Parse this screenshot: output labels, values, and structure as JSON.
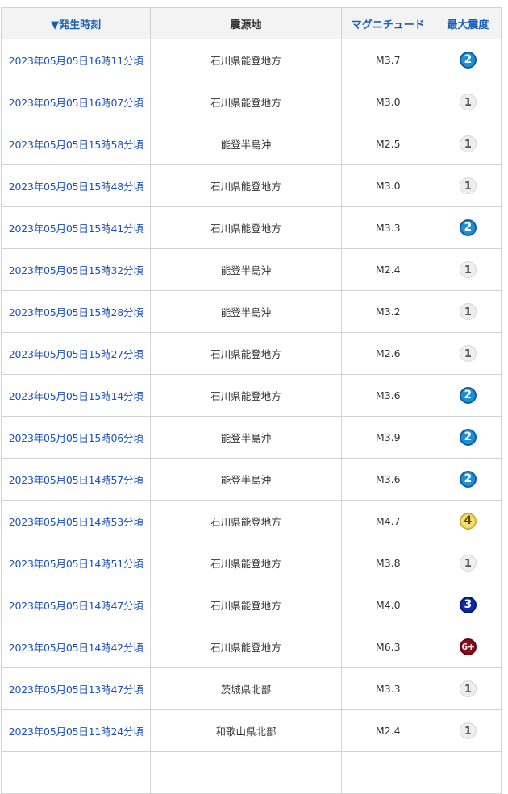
{
  "table": {
    "headers": {
      "time": "▼発生時刻",
      "epicenter": "震源地",
      "magnitude": "マグニチュード",
      "intensity": "最大震度"
    },
    "rows": [
      {
        "time": "2023年05月05日16時11分頃",
        "epicenter": "石川県能登地方",
        "magnitude": "M3.7",
        "intensity": "2",
        "level": "s2"
      },
      {
        "time": "2023年05月05日16時07分頃",
        "epicenter": "石川県能登地方",
        "magnitude": "M3.0",
        "intensity": "1",
        "level": "s1"
      },
      {
        "time": "2023年05月05日15時58分頃",
        "epicenter": "能登半島沖",
        "magnitude": "M2.5",
        "intensity": "1",
        "level": "s1"
      },
      {
        "time": "2023年05月05日15時48分頃",
        "epicenter": "石川県能登地方",
        "magnitude": "M3.0",
        "intensity": "1",
        "level": "s1"
      },
      {
        "time": "2023年05月05日15時41分頃",
        "epicenter": "石川県能登地方",
        "magnitude": "M3.3",
        "intensity": "2",
        "level": "s2"
      },
      {
        "time": "2023年05月05日15時32分頃",
        "epicenter": "能登半島沖",
        "magnitude": "M2.4",
        "intensity": "1",
        "level": "s1"
      },
      {
        "time": "2023年05月05日15時28分頃",
        "epicenter": "能登半島沖",
        "magnitude": "M3.2",
        "intensity": "1",
        "level": "s1"
      },
      {
        "time": "2023年05月05日15時27分頃",
        "epicenter": "石川県能登地方",
        "magnitude": "M2.6",
        "intensity": "1",
        "level": "s1"
      },
      {
        "time": "2023年05月05日15時14分頃",
        "epicenter": "石川県能登地方",
        "magnitude": "M3.6",
        "intensity": "2",
        "level": "s2"
      },
      {
        "time": "2023年05月05日15時06分頃",
        "epicenter": "能登半島沖",
        "magnitude": "M3.9",
        "intensity": "2",
        "level": "s2"
      },
      {
        "time": "2023年05月05日14時57分頃",
        "epicenter": "能登半島沖",
        "magnitude": "M3.6",
        "intensity": "2",
        "level": "s2"
      },
      {
        "time": "2023年05月05日14時53分頃",
        "epicenter": "石川県能登地方",
        "magnitude": "M4.7",
        "intensity": "4",
        "level": "s4"
      },
      {
        "time": "2023年05月05日14時51分頃",
        "epicenter": "石川県能登地方",
        "magnitude": "M3.8",
        "intensity": "1",
        "level": "s1"
      },
      {
        "time": "2023年05月05日14時47分頃",
        "epicenter": "石川県能登地方",
        "magnitude": "M4.0",
        "intensity": "3",
        "level": "s3"
      },
      {
        "time": "2023年05月05日14時42分頃",
        "epicenter": "石川県能登地方",
        "magnitude": "M6.3",
        "intensity": "6+",
        "level": "s6p"
      },
      {
        "time": "2023年05月05日13時47分頃",
        "epicenter": "茨城県北部",
        "magnitude": "M3.3",
        "intensity": "1",
        "level": "s1"
      },
      {
        "time": "2023年05月05日11時24分頃",
        "epicenter": "和歌山県北部",
        "magnitude": "M2.4",
        "intensity": "1",
        "level": "s1"
      },
      {
        "time": "",
        "epicenter": "",
        "magnitude": "",
        "intensity": "",
        "level": ""
      }
    ]
  },
  "colors": {
    "link": "#1e52b8",
    "header_bg": "#f3f3f3",
    "border": "#d2d2d2",
    "intensity_1": "#eeeeee",
    "intensity_2": "#1d8fd8",
    "intensity_3": "#0a2aa6",
    "intensity_4": "#f2de70",
    "intensity_6_plus": "#8a0d1f"
  }
}
